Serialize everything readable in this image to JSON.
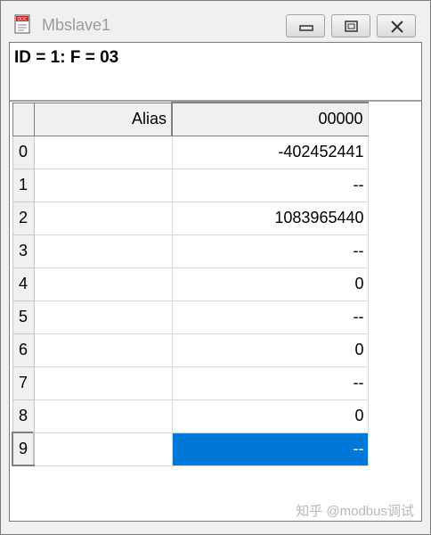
{
  "window": {
    "title": "Mbslave1",
    "app_icon_text": "DOC",
    "controls": [
      "minimize-icon",
      "maximize-icon",
      "close-icon"
    ]
  },
  "header": {
    "text": "ID = 1: F = 03"
  },
  "table": {
    "columns": [
      "Alias",
      "00000"
    ],
    "rows": [
      {
        "index": "0",
        "alias": "",
        "value": "-402452441"
      },
      {
        "index": "1",
        "alias": "",
        "value": "--"
      },
      {
        "index": "2",
        "alias": "",
        "value": "1083965440"
      },
      {
        "index": "3",
        "alias": "",
        "value": "--"
      },
      {
        "index": "4",
        "alias": "",
        "value": "0"
      },
      {
        "index": "5",
        "alias": "",
        "value": "--"
      },
      {
        "index": "6",
        "alias": "",
        "value": "0"
      },
      {
        "index": "7",
        "alias": "",
        "value": "--"
      },
      {
        "index": "8",
        "alias": "",
        "value": "0"
      },
      {
        "index": "9",
        "alias": "",
        "value": "--"
      }
    ],
    "selected_row": 9
  },
  "watermark": "知乎 @modbus调试"
}
